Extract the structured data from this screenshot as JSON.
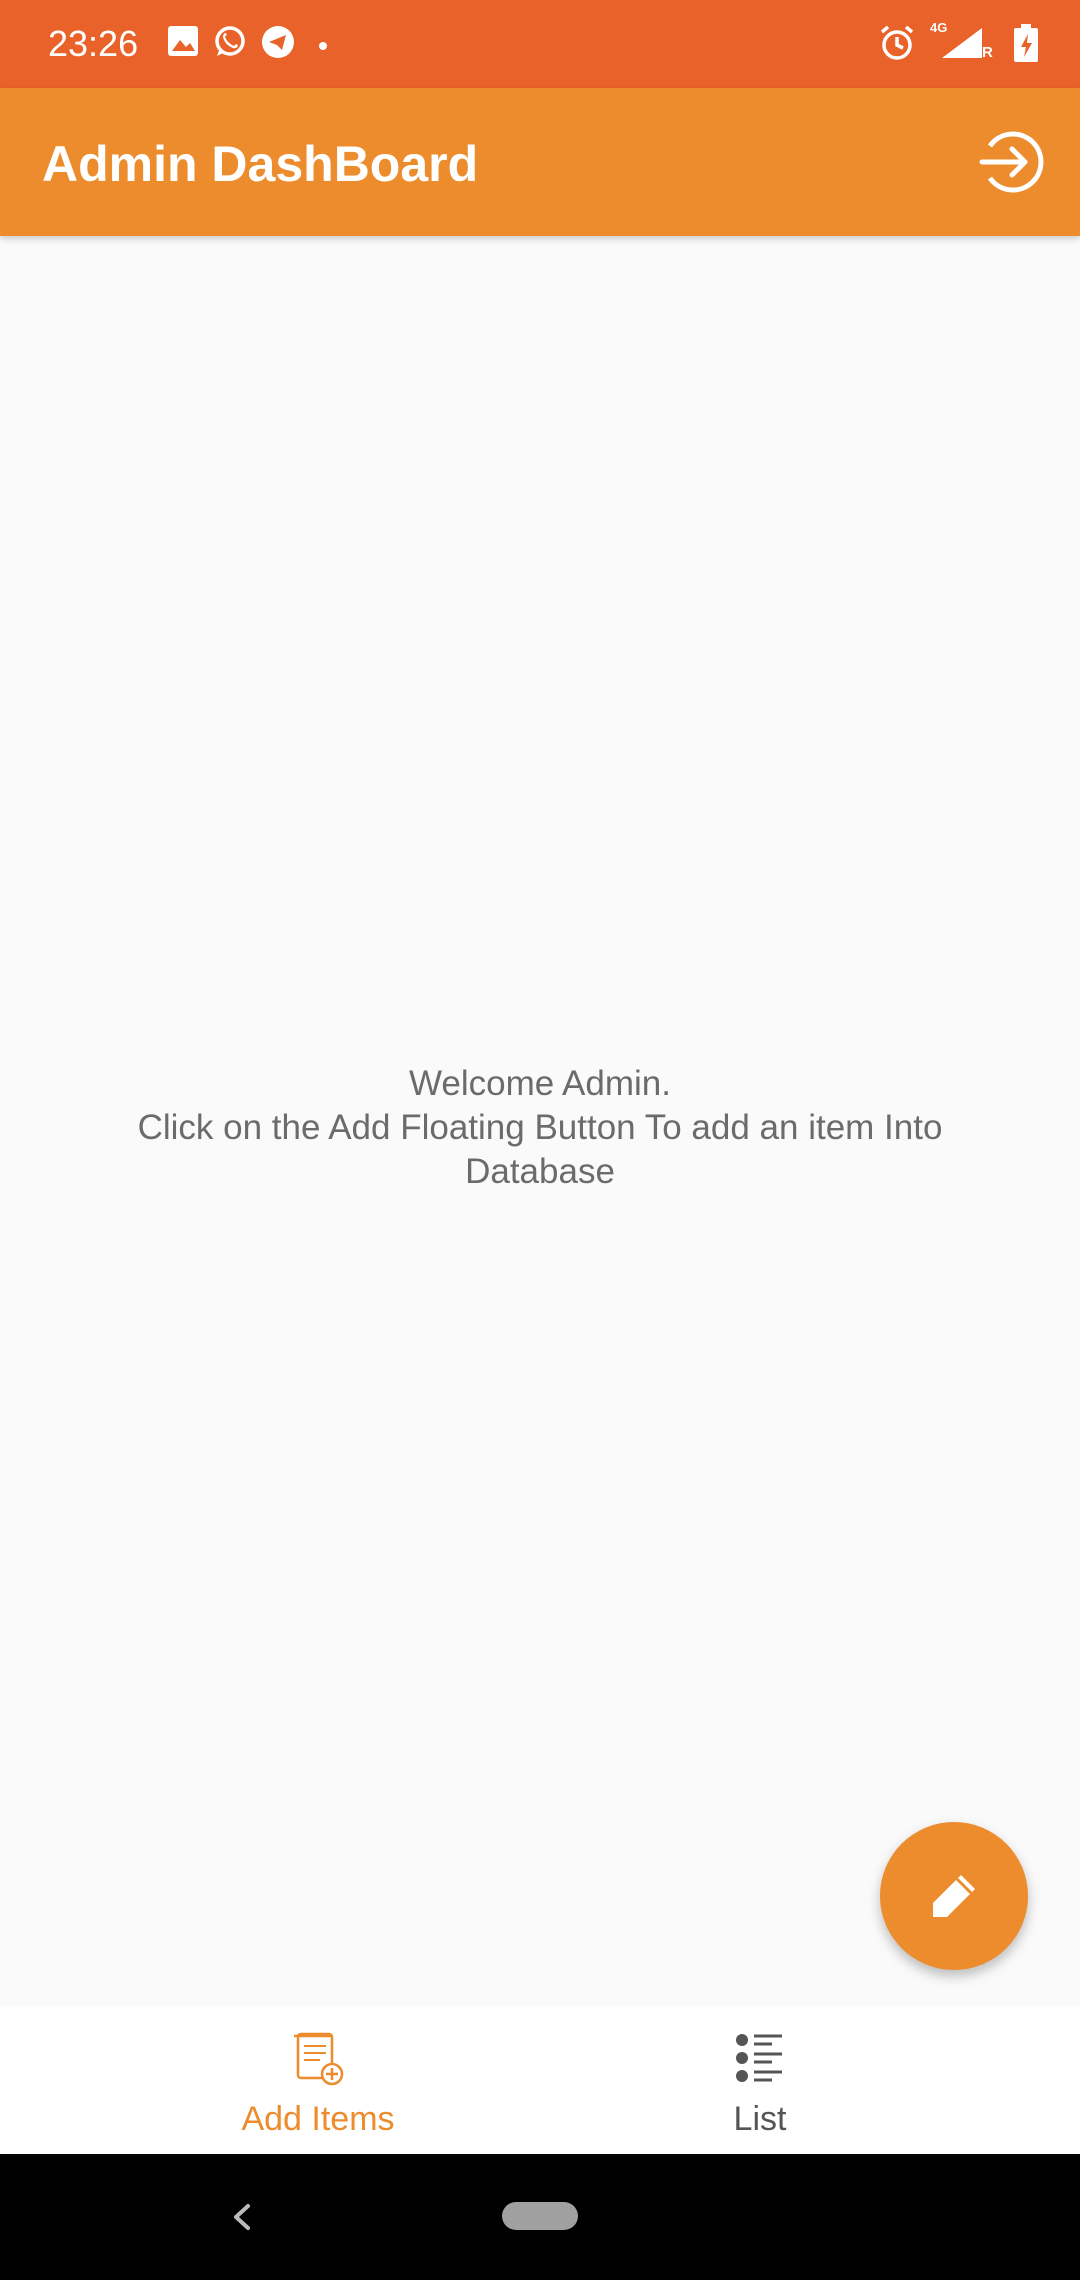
{
  "status_bar": {
    "time": "23:26",
    "left_icons": [
      "image-icon",
      "whatsapp-icon",
      "telegram-icon",
      "dot-icon"
    ],
    "right_icons": [
      "alarm-icon",
      "signal-4g-icon",
      "battery-charging-icon"
    ],
    "network_label": "4G",
    "roaming_label": "R"
  },
  "app_bar": {
    "title": "Admin DashBoard",
    "action_icon": "logout-icon"
  },
  "main": {
    "welcome_text": "Welcome Admin.\nClick on the Add Floating Button To add an item Into Database"
  },
  "fab": {
    "icon": "pencil-icon"
  },
  "bottom_nav": {
    "items": [
      {
        "label": "Add Items",
        "icon": "add-document-icon",
        "active": true
      },
      {
        "label": "List",
        "icon": "list-icon",
        "active": false
      }
    ]
  },
  "colors": {
    "status_bar": "#e8622a",
    "accent": "#ec8c2c",
    "background": "#fafafa",
    "text_muted": "#6b6b6b"
  }
}
